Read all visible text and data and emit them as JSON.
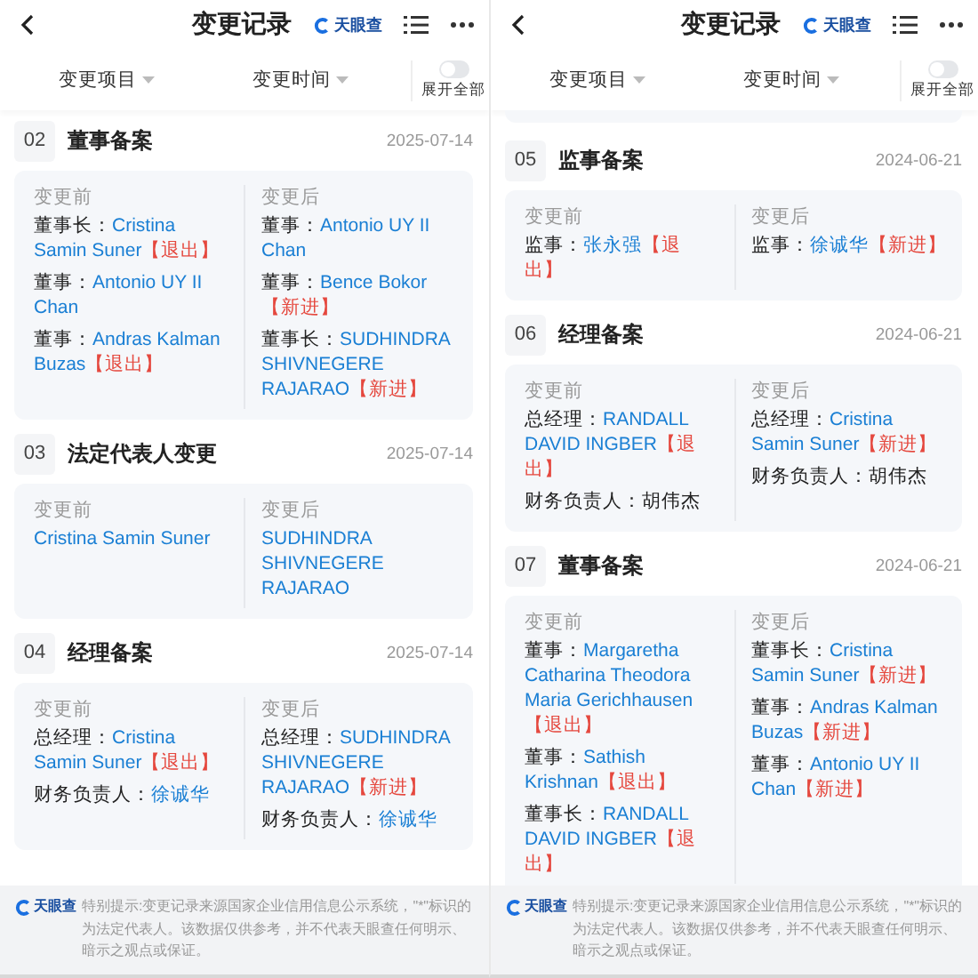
{
  "panels": [
    {
      "header": {
        "title": "变更记录",
        "brand": "天眼查"
      },
      "filters": [
        {
          "label": "变更项目"
        },
        {
          "label": "变更时间"
        }
      ],
      "toggle": {
        "label": "展开全部",
        "on": false
      },
      "card_tail": false,
      "records": [
        {
          "number": "02",
          "title": "董事备案",
          "date": "2025-07-14",
          "before": {
            "label": "变更前",
            "entries": [
              {
                "role": "董事长：",
                "name": "Cristina Samin Suner",
                "linked": true,
                "tag": "【退出】"
              },
              {
                "role": "董事：",
                "name": "Antonio UY II Chan",
                "linked": true
              },
              {
                "role": "董事：",
                "name": "Andras Kalman Buzas",
                "linked": true,
                "tag": "【退出】"
              }
            ]
          },
          "after": {
            "label": "变更后",
            "entries": [
              {
                "role": "董事：",
                "name": "Antonio UY II Chan",
                "linked": true
              },
              {
                "role": "董事：",
                "name": "Bence Bokor",
                "linked": true,
                "tag": "【新进】"
              },
              {
                "role": "董事长：",
                "name": "SUDHINDRA SHIVNEGERE RAJARAO",
                "linked": true,
                "tag": "【新进】"
              }
            ]
          }
        },
        {
          "number": "03",
          "title": "法定代表人变更",
          "date": "2025-07-14",
          "before": {
            "label": "变更前",
            "entries": [
              {
                "name": "Cristina Samin Suner",
                "linked": true
              }
            ]
          },
          "after": {
            "label": "变更后",
            "entries": [
              {
                "name": "SUDHINDRA SHIVNEGERE RAJARAO",
                "linked": true
              }
            ]
          }
        },
        {
          "number": "04",
          "title": "经理备案",
          "date": "2025-07-14",
          "before": {
            "label": "变更前",
            "entries": [
              {
                "role": "总经理：",
                "name": "Cristina Samin Suner",
                "linked": true,
                "tag": "【退出】"
              },
              {
                "role": "财务负责人：",
                "name": "徐诚华",
                "linked": true
              }
            ]
          },
          "after": {
            "label": "变更后",
            "entries": [
              {
                "role": "总经理：",
                "name": "SUDHINDRA SHIVNEGERE RAJARAO",
                "linked": true,
                "tag": "【新进】"
              },
              {
                "role": "财务负责人：",
                "name": "徐诚华",
                "linked": true
              }
            ]
          }
        }
      ],
      "footer": {
        "brand": "天眼查",
        "note": "特别提示:变更记录来源国家企业信用信息公示系统，\"*\"标识的为法定代表人。该数据仅供参考，并不代表天眼查任何明示、暗示之观点或保证。"
      }
    },
    {
      "header": {
        "title": "变更记录",
        "brand": "天眼查"
      },
      "filters": [
        {
          "label": "变更项目"
        },
        {
          "label": "变更时间"
        }
      ],
      "toggle": {
        "label": "展开全部",
        "on": false
      },
      "card_tail": true,
      "records": [
        {
          "number": "05",
          "title": "监事备案",
          "date": "2024-06-21",
          "before": {
            "label": "变更前",
            "entries": [
              {
                "role": "监事：",
                "name": "张永强",
                "linked": true,
                "tag": "【退出】"
              }
            ]
          },
          "after": {
            "label": "变更后",
            "entries": [
              {
                "role": "监事：",
                "name": "徐诚华",
                "linked": true,
                "tag": "【新进】"
              }
            ]
          }
        },
        {
          "number": "06",
          "title": "经理备案",
          "date": "2024-06-21",
          "before": {
            "label": "变更前",
            "entries": [
              {
                "role": "总经理：",
                "name": "RANDALL DAVID INGBER",
                "linked": true,
                "tag": "【退出】"
              },
              {
                "role": "财务负责人：",
                "name": "胡伟杰",
                "linked": false
              }
            ]
          },
          "after": {
            "label": "变更后",
            "entries": [
              {
                "role": "总经理：",
                "name": "Cristina Samin Suner",
                "linked": true,
                "tag": "【新进】"
              },
              {
                "role": "财务负责人：",
                "name": "胡伟杰",
                "linked": false
              }
            ]
          }
        },
        {
          "number": "07",
          "title": "董事备案",
          "date": "2024-06-21",
          "before": {
            "label": "变更前",
            "entries": [
              {
                "role": "董事：",
                "name": "Margaretha Catharina Theodora Maria Gerichhausen",
                "linked": true,
                "tag": "【退出】"
              },
              {
                "role": "董事：",
                "name": "Sathish Krishnan",
                "linked": true,
                "tag": "【退出】"
              },
              {
                "role": "董事长：",
                "name": "RANDALL DAVID INGBER",
                "linked": true,
                "tag": "【退出】"
              }
            ]
          },
          "after": {
            "label": "变更后",
            "entries": [
              {
                "role": "董事长：",
                "name": "Cristina Samin Suner",
                "linked": true,
                "tag": "【新进】"
              },
              {
                "role": "董事：",
                "name": "Andras Kalman Buzas",
                "linked": true,
                "tag": "【新进】"
              },
              {
                "role": "董事：",
                "name": "Antonio UY II Chan",
                "linked": true,
                "tag": "【新进】"
              }
            ]
          }
        }
      ],
      "footer": {
        "brand": "天眼查",
        "note": "特别提示:变更记录来源国家企业信用信息公示系统，\"*\"标识的为法定代表人。该数据仅供参考，并不代表天眼查任何明示、暗示之观点或保证。"
      }
    }
  ]
}
